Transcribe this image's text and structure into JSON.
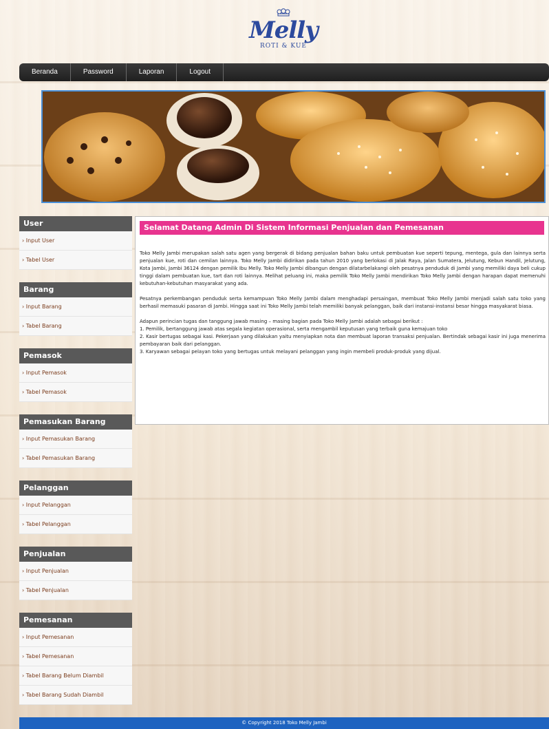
{
  "logo": {
    "name": "Melly",
    "tagline": "ROTI & KUE"
  },
  "nav": [
    "Beranda",
    "Password",
    "Laporan",
    "Logout"
  ],
  "sidebar": [
    {
      "title": "User",
      "items": [
        "› Input User",
        "› Tabel User"
      ]
    },
    {
      "title": "Barang",
      "items": [
        "› Input Barang",
        "› Tabel Barang"
      ]
    },
    {
      "title": "Pemasok",
      "items": [
        "› Input Pemasok",
        "› Tabel Pemasok"
      ]
    },
    {
      "title": "Pemasukan Barang",
      "items": [
        "› Input Pemasukan Barang",
        "› Tabel Pemasukan Barang"
      ]
    },
    {
      "title": "Pelanggan",
      "items": [
        "› Input Pelanggan",
        "› Tabel Pelanggan"
      ]
    },
    {
      "title": "Penjualan",
      "items": [
        "› Input Penjualan",
        "› Tabel Penjualan"
      ]
    },
    {
      "title": "Pemesanan",
      "items": [
        "› Input Pemesanan",
        "› Tabel Pemesanan",
        "› Tabel Barang Belum Diambil",
        "› Tabel Barang Sudah Diambil"
      ]
    }
  ],
  "main": {
    "title": "Selamat Datang Admin Di Sistem Informasi Penjualan dan Pemesanan",
    "p1": "Toko Melly Jambi merupakan salah satu agen yang bergerak di bidang penjualan bahan baku untuk pembuatan kue seperti tepung, mentega, gula dan lainnya serta penjualan kue, roti dan cemilan lainnya. Toko Melly Jambi didirikan pada tahun 2010 yang berlokasi di Jalak Raya, Jalan Sumatera, Jelutung, Kebun Handil, Jelutung, Kota Jambi, Jambi 36124 dengan pemilik Ibu Melly. Toko Melly Jambi dibangun dengan dilatarbelakangi oleh pesatnya penduduk di Jambi yang memiliki daya beli cukup tinggi dalam pembuatan kue, tart dan roti lainnya. Melihat peluang ini, maka pemilik Toko Melly Jambi mendirikan Toko Melly Jambi dengan harapan dapat memenuhi kebutuhan-kebutuhan masyarakat yang ada.",
    "p2": "Pesatnya perkembangan penduduk serta kemampuan Toko Melly Jambi dalam menghadapi persaingan, membuat Toko Melly Jambi menjadi salah satu toko yang berhasil memasuki pasaran di Jambi. Hingga saat ini Toko Melly Jambi telah memiliki banyak pelanggan, baik dari instansi-instansi besar hingga masyakarat biasa.",
    "intro": "Adapun perincian tugas dan tanggung jawab masing – masing bagian pada Toko Melly Jambi adalah sebagai berikut :",
    "list": [
      "1. Pemilik, bertanggung jawab atas segala kegiatan operasional, serta mengambil keputusan yang terbaik guna kemajuan toko",
      "2. Kasir bertugas sebagai kasi. Pekerjaan yang dilakukan yaitu menyiapkan nota dan membuat laporan transaksi penjualan. Bertindak sebagai kasir ini juga menerima pembayaran baik dari pelanggan.",
      "3. Karyawan sebagai pelayan toko yang bertugas untuk melayani pelanggan yang ingin membeli produk-produk yang dijual."
    ]
  },
  "footer": "© Copyright 2018 Toko Melly Jambi"
}
